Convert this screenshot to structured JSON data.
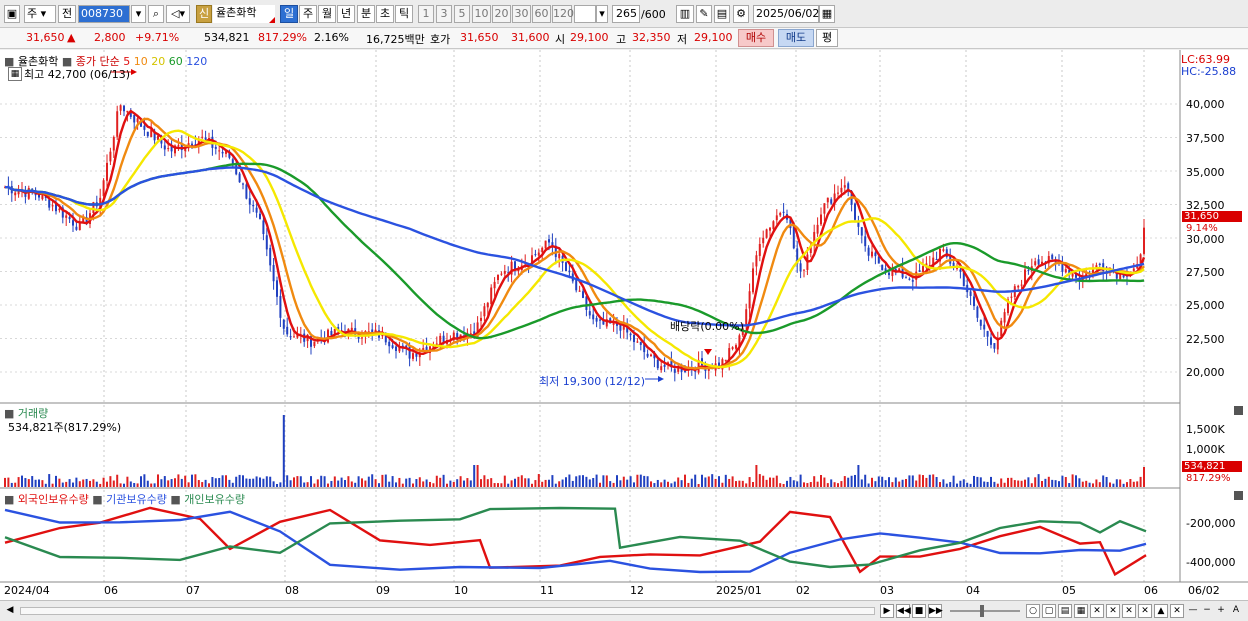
{
  "toolbar": {
    "type_select": "주",
    "market_select": "전",
    "code": "008730",
    "badge": "신",
    "name": "율촌화학",
    "periods": [
      "일",
      "주",
      "월",
      "년",
      "분",
      "초",
      "틱"
    ],
    "intervals": [
      "1",
      "3",
      "5",
      "10",
      "20",
      "30",
      "60",
      "120"
    ],
    "count": "265",
    "count_total": "/600",
    "date": "2025/06/02"
  },
  "quote": {
    "price": "31,650",
    "change_arrow": "▲",
    "change": "2,800",
    "change_pct": "+9.71%",
    "volume": "534,821",
    "volume_ratio": "817.29%",
    "turnover": "2.16%",
    "amount": "16,725백만",
    "ask_label": "호가",
    "ask": "31,650",
    "bid": "31,600",
    "open_label": "시",
    "open": "29,100",
    "high_label": "고",
    "high": "32,350",
    "low_label": "저",
    "low": "29,100",
    "buy_label": "매수",
    "sell_label": "매도",
    "avg_label": "평"
  },
  "price_panel": {
    "legend_name": "율촌화학",
    "legend_ma": "종가 단순",
    "ma_periods": [
      "5",
      "10",
      "20",
      "60",
      "120"
    ],
    "ma_colors": [
      "#e01010",
      "#f08a10",
      "#f5e800",
      "#1a9a2a",
      "#2b52e0"
    ],
    "max_label": "최고 42,700 (06/13)",
    "min_label": "최저 19,300 (12/12)",
    "dividend_label": "배당락(0.00%)",
    "lc": "LC:63.99",
    "hc": "HC:-25.88",
    "last_price": "31,650",
    "last_pct": "9.14%",
    "y_ticks": [
      "40,000",
      "37,500",
      "35,000",
      "32,500",
      "30,000",
      "27,500",
      "25,000",
      "22,500",
      "20,000"
    ]
  },
  "volume_panel": {
    "title": "거래량",
    "value": "534,821주(817.29%)",
    "y_ticks": [
      "1,500K",
      "1,000K"
    ],
    "last": "534,821",
    "last_pct": "817.29%"
  },
  "holder_panel": {
    "series": [
      {
        "name": "외국인보유수량",
        "color": "#e01010"
      },
      {
        "name": "기관보유수량",
        "color": "#2b52e0"
      },
      {
        "name": "개인보유수량",
        "color": "#2a8a50"
      }
    ],
    "y_ticks": [
      "-200,000",
      "-400,000"
    ]
  },
  "x_axis": [
    "2024/04",
    "06",
    "07",
    "08",
    "09",
    "10",
    "11",
    "12",
    "2025/01",
    "02",
    "03",
    "04",
    "05",
    "06",
    "06/02"
  ]
}
